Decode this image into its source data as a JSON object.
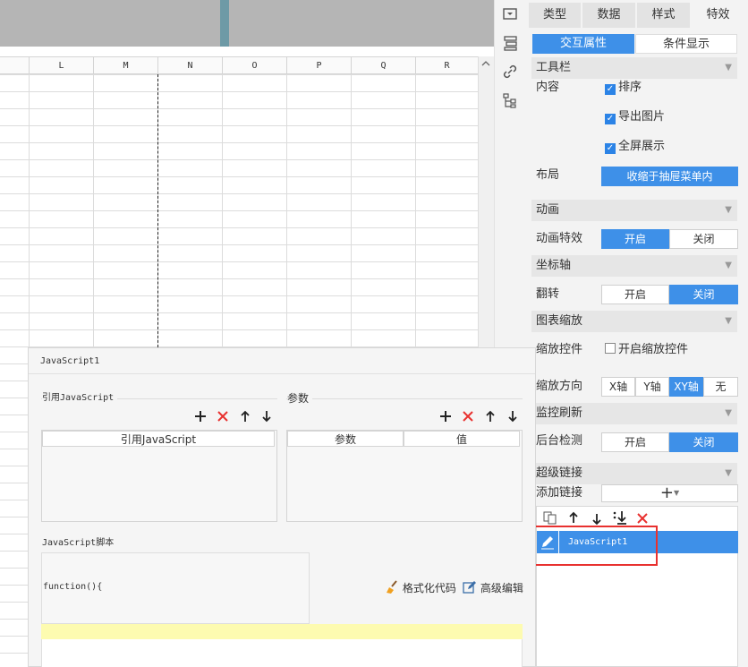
{
  "sheet": {
    "columns": [
      "L",
      "M",
      "N",
      "O",
      "P",
      "Q",
      "R"
    ]
  },
  "tabs": [
    {
      "label": "类型"
    },
    {
      "label": "数据"
    },
    {
      "label": "样式"
    },
    {
      "label": "特效"
    }
  ],
  "subtabs": [
    {
      "label": "交互属性"
    },
    {
      "label": "条件显示"
    }
  ],
  "toolbar_section": {
    "title": "工具栏",
    "content_label": "内容",
    "options": [
      {
        "label": "排序",
        "checked": true
      },
      {
        "label": "导出图片",
        "checked": true
      },
      {
        "label": "全屏展示",
        "checked": true
      }
    ],
    "layout_label": "布局",
    "layout_value": "收缩于抽屉菜单内"
  },
  "animation_section": {
    "title": "动画",
    "effect_label": "动画特效",
    "on": "开启",
    "off": "关闭",
    "selected": "on"
  },
  "axis_section": {
    "title": "坐标轴",
    "flip_label": "翻转",
    "on": "开启",
    "off": "关闭",
    "selected": "off"
  },
  "zoom_section": {
    "title": "图表缩放",
    "control_label": "缩放控件",
    "control_checkbox": "开启缩放控件",
    "direction_label": "缩放方向",
    "directions": [
      "X轴",
      "Y轴",
      "XY轴",
      "无"
    ],
    "selected_direction": "XY轴"
  },
  "monitor_section": {
    "title": "监控刷新",
    "bg_label": "后台检测",
    "on": "开启",
    "off": "关闭",
    "selected": "off"
  },
  "hyperlink_section": {
    "title": "超级链接",
    "add_label": "添加链接",
    "add_symbol": "+",
    "items": [
      {
        "label": "JavaScript1",
        "selected": true
      }
    ]
  },
  "dialog": {
    "title": "JavaScript1",
    "ref_group": "引用JavaScript",
    "ref_column": "引用JavaScript",
    "param_group": "参数",
    "param_columns": [
      "参数",
      "值"
    ],
    "script_group": "JavaScript脚本",
    "code": "function(){",
    "format_code": "格式化代码",
    "advanced_edit": "高级编辑"
  },
  "colors": {
    "accent": "#3e90e8",
    "danger": "#e8312f",
    "highlight": "#fdfbb0"
  }
}
